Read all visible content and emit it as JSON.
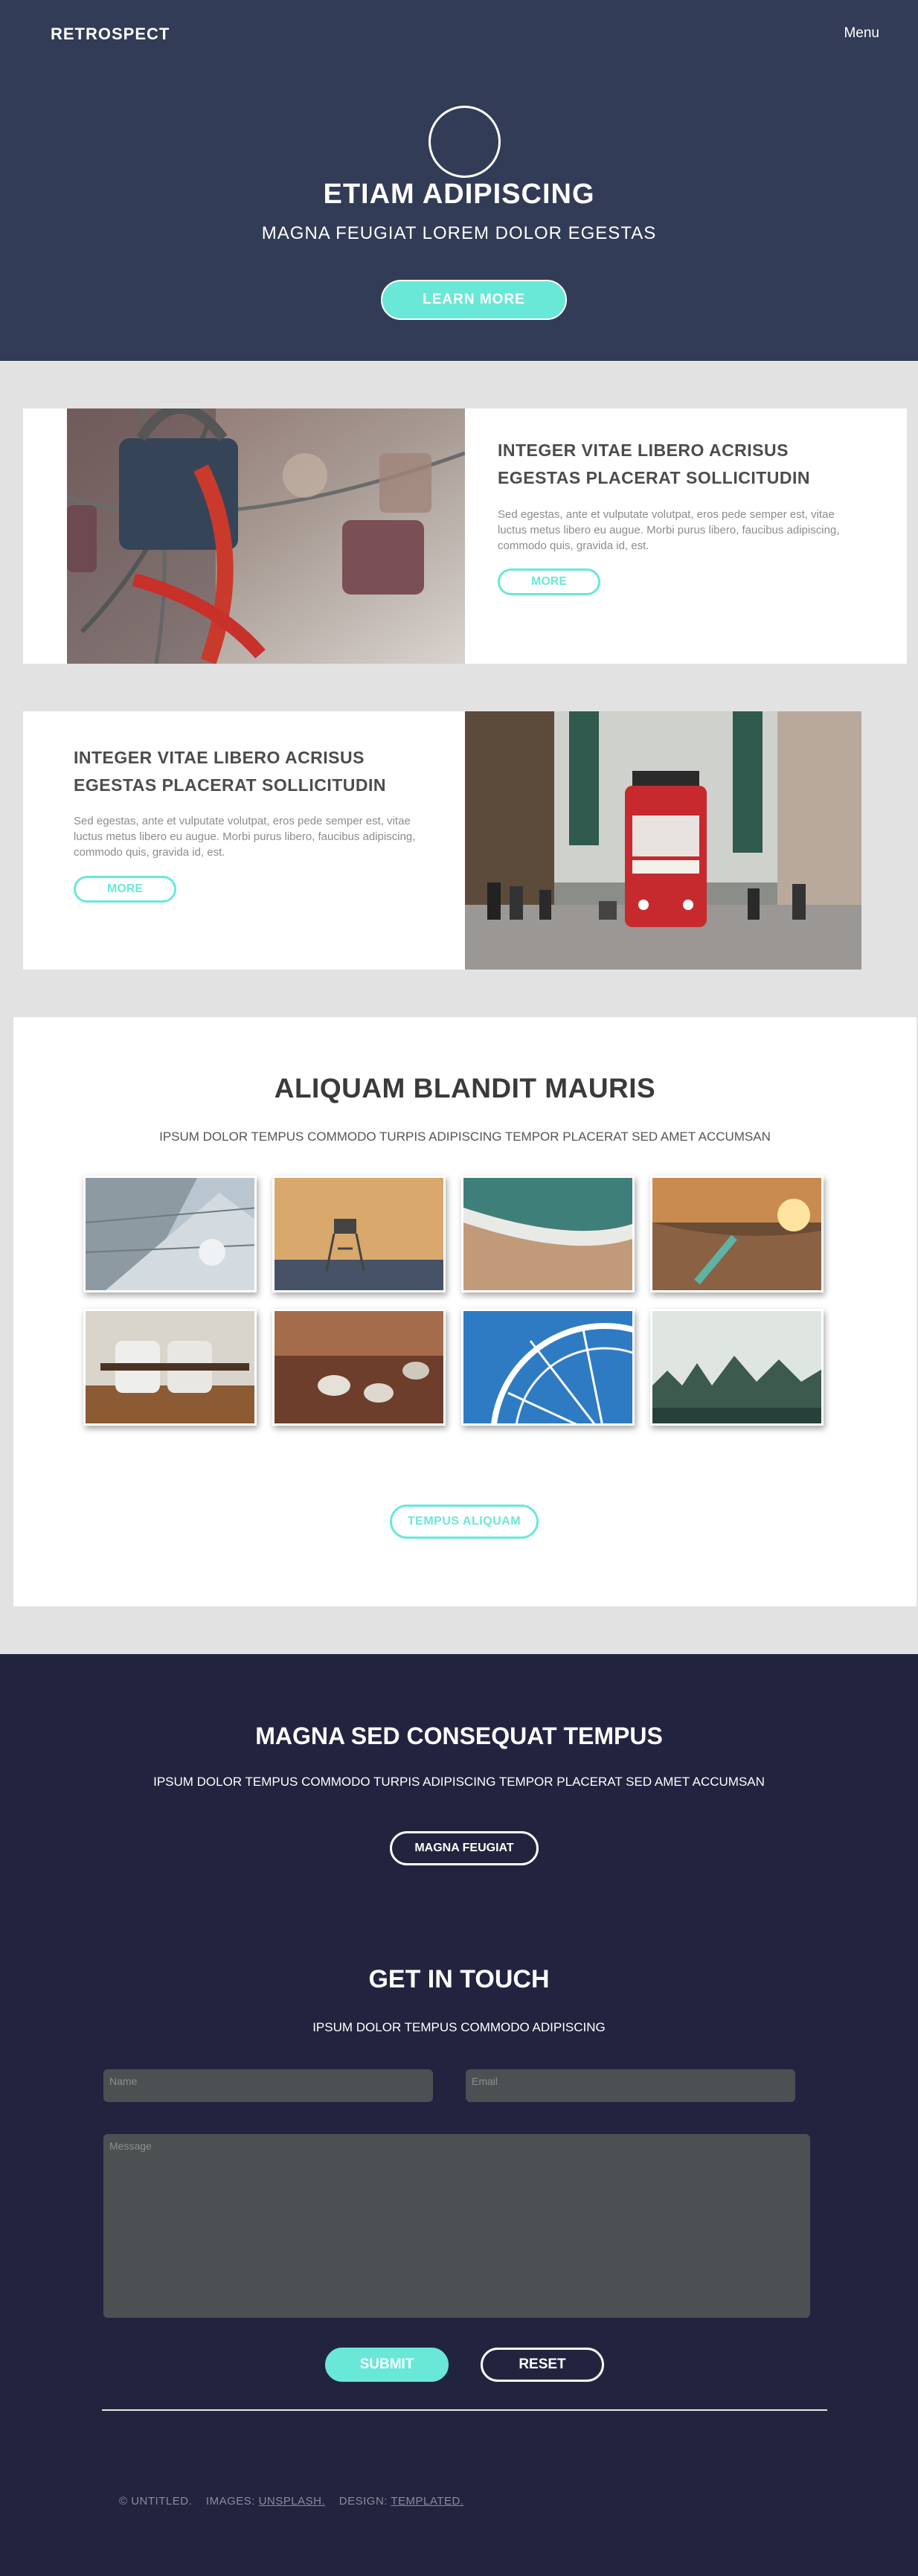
{
  "header": {
    "logo": "RETROSPECT",
    "menu_label": "Menu"
  },
  "banner": {
    "title": "ETIAM ADIPISCING",
    "subtitle": "MAGNA FEUGIAT LOREM DOLOR EGESTAS",
    "button": "LEARN MORE"
  },
  "spotlights": [
    {
      "heading": "INTEGER VITAE LIBERO ACRISUS EGESTAS PLACERAT SOLLICITUDIN",
      "text": "Sed egestas, ante et vulputate volutpat, eros pede semper est, vitae luctus metus libero eu augue. Morbi purus libero, faucibus adipiscing, commodo quis, gravida id, est.",
      "button": "MORE"
    },
    {
      "heading": "INTEGER VITAE LIBERO ACRISUS EGESTAS PLACERAT SOLLICITUDIN",
      "text": "Sed egestas, ante et vulputate volutpat, eros pede semper est, vitae luctus metus libero eu augue. Morbi purus libero, faucibus adipiscing, commodo quis, gravida id, est.",
      "button": "MORE"
    }
  ],
  "gallery": {
    "title": "ALIQUAM BLANDIT MAURIS",
    "subtitle": "IPSUM DOLOR TEMPUS COMMODO TURPIS ADIPISCING TEMPOR PLACERAT SED AMET ACCUMSAN",
    "button": "TEMPUS ALIQUAM"
  },
  "cta": {
    "title": "MAGNA SED CONSEQUAT TEMPUS",
    "subtitle": "IPSUM DOLOR TEMPUS COMMODO TURPIS ADIPISCING TEMPOR PLACERAT SED AMET ACCUMSAN",
    "button": "MAGNA FEUGIAT"
  },
  "contact": {
    "title": "GET IN TOUCH",
    "subtitle": "IPSUM DOLOR TEMPUS COMMODO ADIPISCING",
    "name_placeholder": "Name",
    "email_placeholder": "Email",
    "message_placeholder": "Message",
    "submit": "SUBMIT",
    "reset": "RESET"
  },
  "footer": {
    "copyright": "© UNTITLED.",
    "images_label": "IMAGES:",
    "images_link": "UNSPLASH.",
    "design_label": "DESIGN:",
    "design_link": "TEMPLATED."
  },
  "colors": {
    "accent": "#69e8d8",
    "banner_bg": "#333c56",
    "dark_bg": "#22243f"
  }
}
